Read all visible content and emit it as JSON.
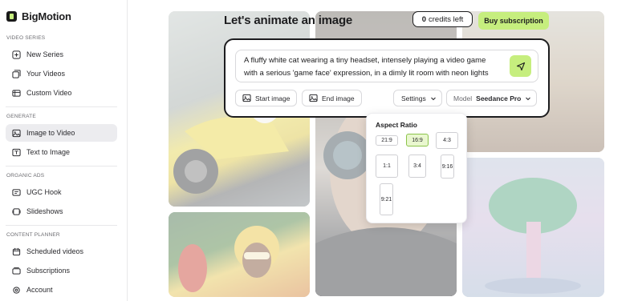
{
  "app": {
    "name": "BigMotion"
  },
  "sidebar": {
    "sections": [
      {
        "title": "VIDEO SERIES",
        "items": [
          "New Series",
          "Your Videos",
          "Custom Video"
        ]
      },
      {
        "title": "GENERATE",
        "items": [
          "Image to Video",
          "Text to Image"
        ]
      },
      {
        "title": "ORGANIC ADS",
        "items": [
          "UGC Hook",
          "Slideshows"
        ]
      },
      {
        "title": "CONTENT PLANNER",
        "items": [
          "Scheduled videos",
          "Subscriptions",
          "Account"
        ]
      }
    ],
    "active_item": "Image to Video",
    "icons": [
      "plus-square-icon",
      "videos-icon",
      "film-icon",
      "image-icon",
      "text-image-icon",
      "ugc-icon",
      "slides-icon",
      "calendar-icon",
      "subscriptions-icon",
      "account-gear-icon"
    ]
  },
  "header": {
    "title": "Let's animate an image",
    "credits_count": "0",
    "credits_suffix": "credits left",
    "buy_label": "Buy subscription"
  },
  "prompt": {
    "line1": "A fluffy white cat wearing a tiny headset, intensely playing a video game",
    "line2": "with a serious 'game face' expression, in a dimly lit room with neon lights",
    "start_image_label": "Start image",
    "end_image_label": "End image",
    "settings_label": "Settings",
    "model_label": "Model",
    "model_value": "Seedance Pro"
  },
  "aspect_ratio": {
    "title": "Aspect Ratio",
    "options": [
      "21:9",
      "16:9",
      "4:3",
      "1:1",
      "3:4",
      "9:16",
      "9:21"
    ],
    "selected": "16:9"
  },
  "colors": {
    "accent": "#c6ee7e",
    "selected_border": "#8bc34a"
  }
}
